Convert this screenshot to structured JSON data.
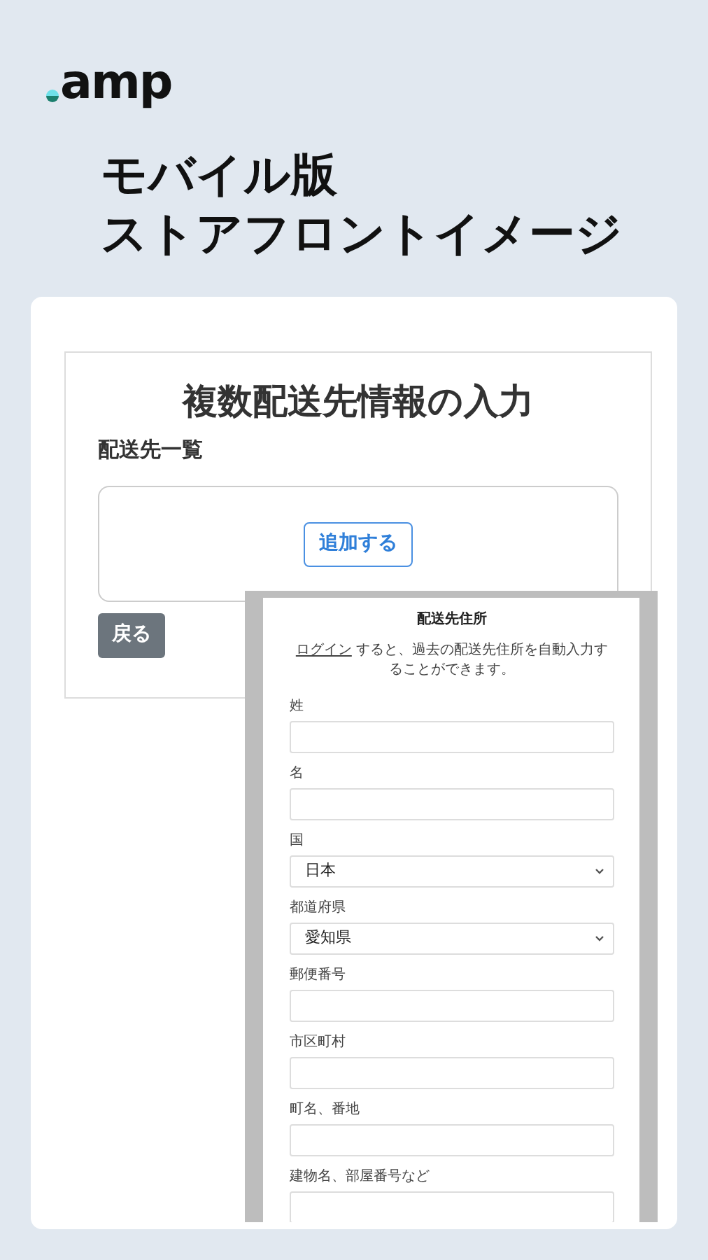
{
  "brand": {
    "name": "amp"
  },
  "headline": [
    "モバイル版",
    "ストアフロントイメージ"
  ],
  "page": {
    "title": "複数配送先情報の入力",
    "section": "配送先一覧",
    "add_button": "追加する",
    "back_button": "戻る"
  },
  "modal": {
    "title": "配送先住所",
    "notice_link": "ログイン",
    "notice": " すると、過去の配送先住所を自動入力することができます。",
    "fields": [
      {
        "label": "姓",
        "kind": "text"
      },
      {
        "label": "名",
        "kind": "text"
      },
      {
        "label": "国",
        "kind": "select",
        "value": "日本"
      },
      {
        "label": "都道府県",
        "kind": "select",
        "value": "愛知県"
      },
      {
        "label": "郵便番号",
        "kind": "text"
      },
      {
        "label": "市区町村",
        "kind": "text"
      },
      {
        "label": "町名、番地",
        "kind": "text"
      },
      {
        "label": "建物名、部屋番号など",
        "kind": "text"
      }
    ]
  }
}
